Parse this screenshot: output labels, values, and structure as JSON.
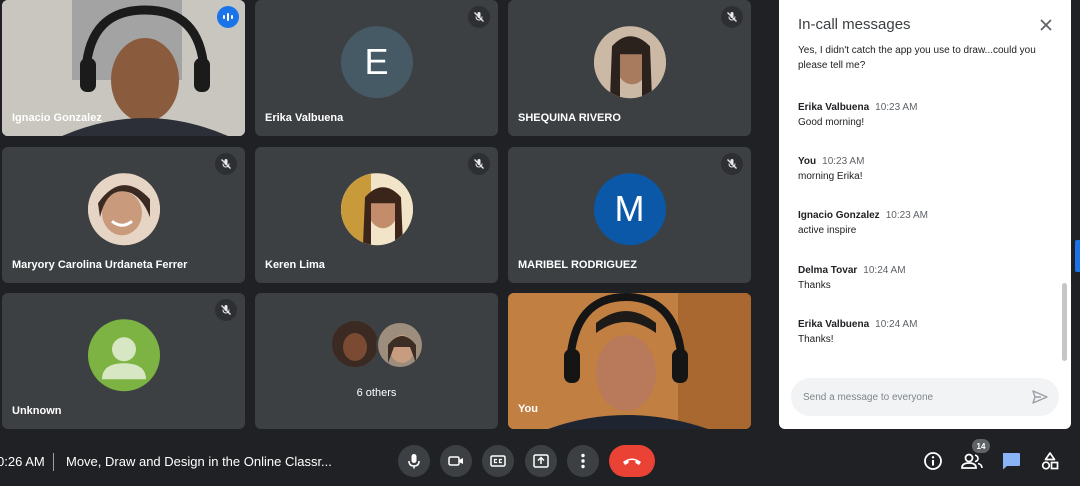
{
  "participants": [
    {
      "name": "Ignacio Gonzalez"
    },
    {
      "name": "Erika Valbuena",
      "initial": "E",
      "color": "#455a64"
    },
    {
      "name": "SHEQUINA RIVERO"
    },
    {
      "name": "Maryory Carolina Urdaneta Ferrer"
    },
    {
      "name": "Keren Lima"
    },
    {
      "name": "MARIBEL RODRIGUEZ",
      "initial": "M",
      "color": "#0b57a8"
    },
    {
      "name": "Unknown",
      "color": "#7cb342"
    },
    {
      "name": "6 others"
    },
    {
      "name": "You"
    }
  ],
  "chat": {
    "title": "In-call messages",
    "partial_message": "Yes, I didn't catch the app you use to draw...could you please tell me?",
    "messages": [
      {
        "sender": "Erika Valbuena",
        "time": "10:23 AM",
        "text": "Good morning!"
      },
      {
        "sender": "You",
        "time": "10:23 AM",
        "text": "morning Erika!"
      },
      {
        "sender": "Ignacio Gonzalez",
        "time": "10:23 AM",
        "text": "active inspire"
      },
      {
        "sender": "Delma Tovar",
        "time": "10:24 AM",
        "text": "Thanks"
      },
      {
        "sender": "Erika Valbuena",
        "time": "10:24 AM",
        "text": "Thanks!"
      }
    ],
    "input_placeholder": "Send a message to everyone"
  },
  "bottom_bar": {
    "time": "0:26 AM",
    "meeting_title": "Move, Draw and Design in the Online Classr...",
    "people_count": "14"
  },
  "colors": {
    "accent": "#1a73e8",
    "hangup": "#ea4335",
    "chat_active": "#8ab4f8"
  }
}
